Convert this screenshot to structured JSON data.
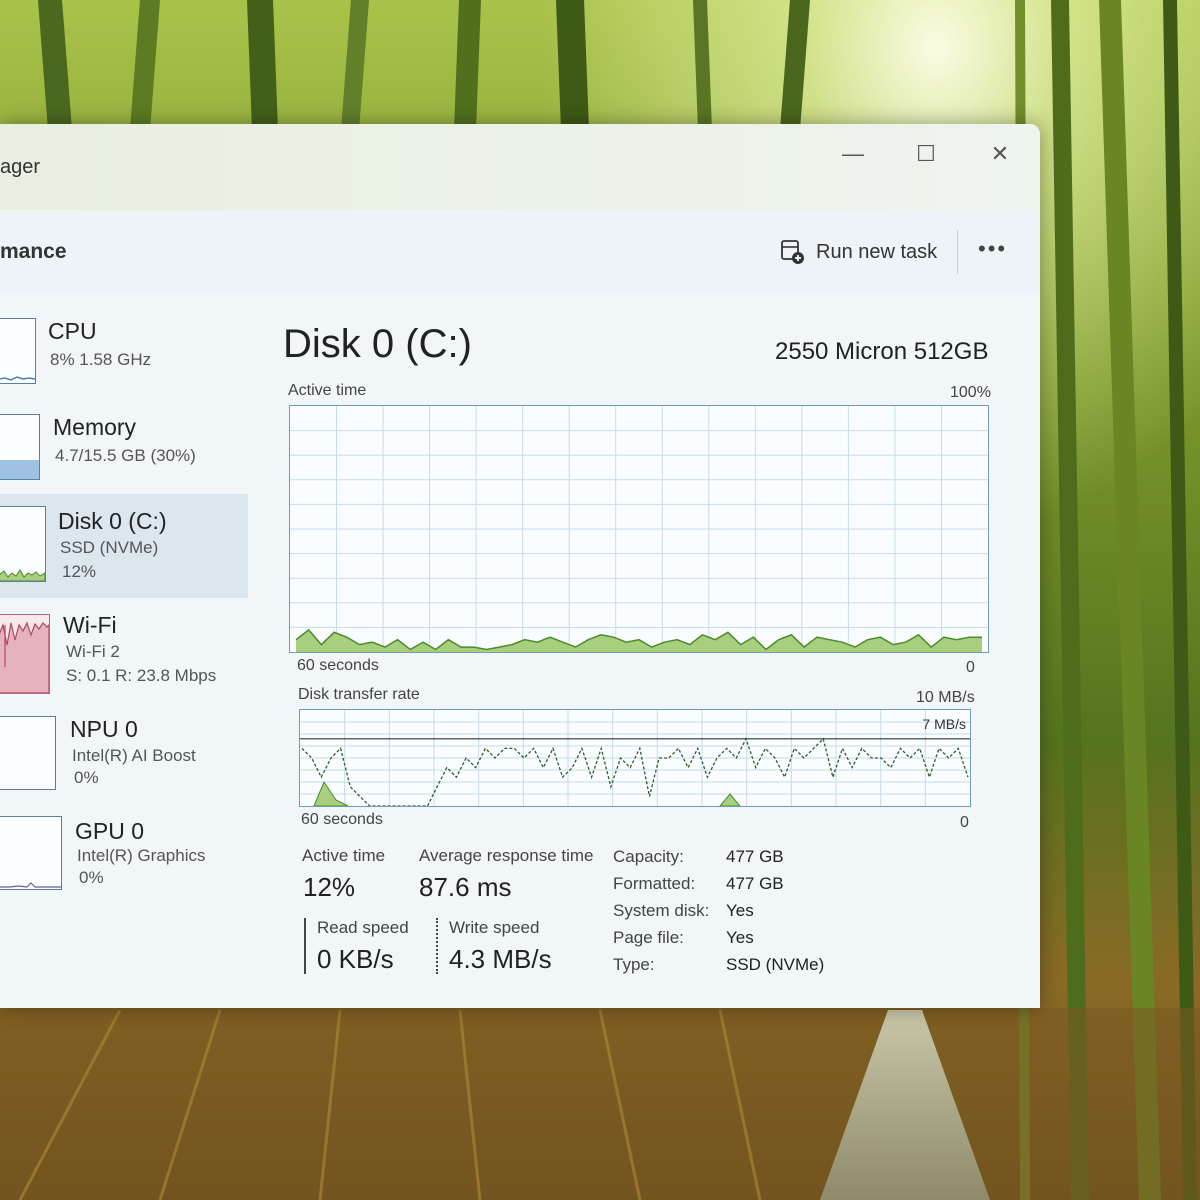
{
  "window": {
    "title": "ager",
    "controls": {
      "minimize": "—",
      "maximize": "☐",
      "close": "✕"
    }
  },
  "commandbar": {
    "section_title": "mance",
    "run_new_task": "Run new task",
    "more": "•••"
  },
  "sidebar": {
    "items": [
      {
        "name": "CPU",
        "sub1": "8%  1.58 GHz"
      },
      {
        "name": "Memory",
        "sub1": "4.7/15.5 GB (30%)"
      },
      {
        "name": "Disk 0 (C:)",
        "sub1": "SSD (NVMe)",
        "sub2": "12%"
      },
      {
        "name": "Wi-Fi",
        "sub1": "Wi-Fi 2",
        "sub2": "S: 0.1  R: 23.8 Mbps"
      },
      {
        "name": "NPU 0",
        "sub1": "Intel(R) AI Boost",
        "sub2": "0%"
      },
      {
        "name": "GPU 0",
        "sub1": "Intel(R) Graphics",
        "sub2": "0%"
      }
    ],
    "thumb_levels": {
      "cpu": 0.08,
      "memory": 0.3,
      "disk": 0.12,
      "npu": 0.0,
      "gpu": 0.0
    }
  },
  "main": {
    "title": "Disk 0 (C:)",
    "model": "2550 Micron 512GB",
    "active_graph": {
      "label": "Active time",
      "max_label": "100%",
      "time_label": "60 seconds",
      "zero_label": "0",
      "values": [
        5,
        9,
        3,
        8,
        6,
        3,
        4,
        2,
        5,
        1,
        4,
        1,
        5,
        2,
        2,
        1,
        2,
        3,
        5,
        4,
        6,
        4,
        2,
        5,
        7,
        6,
        4,
        5,
        2,
        4,
        5,
        3,
        7,
        5,
        8,
        3,
        6,
        1,
        5,
        7,
        2,
        6,
        5,
        4,
        2,
        5,
        6,
        3,
        4,
        7,
        2,
        6,
        5,
        6,
        6
      ]
    },
    "transfer_graph": {
      "label": "Disk transfer rate",
      "max_label": "10 MB/s",
      "line_label": "7 MB/s",
      "time_label": "60 seconds",
      "zero_label": "0",
      "write_values": [
        6,
        5,
        3,
        5,
        6,
        2,
        1,
        0,
        0,
        0,
        0,
        0,
        0,
        0,
        2,
        4,
        3,
        5,
        4,
        6,
        5,
        6,
        6,
        5,
        6,
        4,
        6,
        3,
        4,
        6,
        3,
        6,
        2,
        5,
        4,
        6,
        1,
        5,
        5,
        6,
        4,
        6,
        3,
        5,
        6,
        5,
        7,
        4,
        6,
        5,
        3,
        6,
        5,
        6,
        7,
        3,
        6,
        4,
        6,
        5,
        5,
        4,
        6,
        5,
        6,
        3,
        6,
        5,
        6,
        3
      ]
    },
    "stats": {
      "active_time_label": "Active time",
      "active_time_value": "12%",
      "avg_response_label": "Average response time",
      "avg_response_value": "87.6 ms",
      "read_label": "Read speed",
      "read_value": "0 KB/s",
      "write_label": "Write speed",
      "write_value": "4.3 MB/s"
    },
    "properties": [
      {
        "key": "Capacity:",
        "value": "477 GB"
      },
      {
        "key": "Formatted:",
        "value": "477 GB"
      },
      {
        "key": "System disk:",
        "value": "Yes"
      },
      {
        "key": "Page file:",
        "value": "Yes"
      },
      {
        "key": "Type:",
        "value": "SSD (NVMe)"
      }
    ]
  },
  "colors": {
    "disk_fill": "#a8cf7e",
    "disk_line": "#4d8a2a",
    "grid": "#c7dbe8",
    "memory_fill": "#9ec1e4",
    "wifi_fill": "#e4b3bd",
    "cpu_line": "#4f7fb0"
  }
}
